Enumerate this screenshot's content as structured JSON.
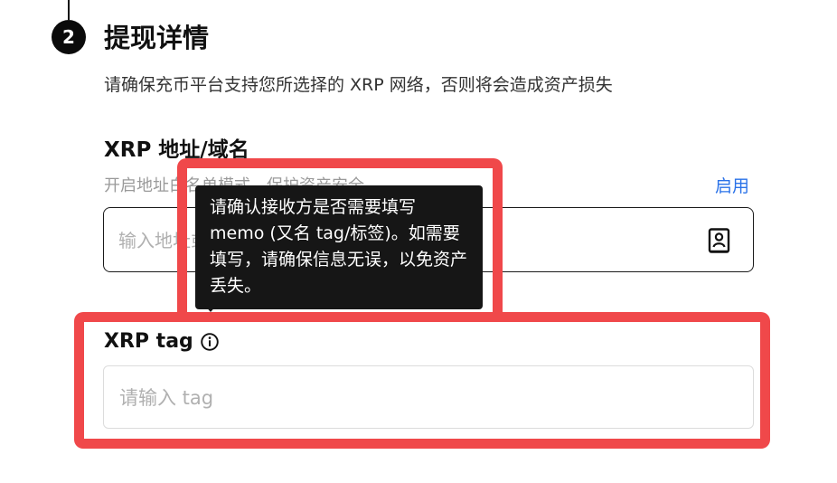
{
  "step": {
    "number": "2",
    "title": "提现详情"
  },
  "notice": "请确保充币平台支持您所选择的 XRP 网络，否则将会造成资产损失",
  "address": {
    "label": "XRP 地址/域名",
    "whitelist_hint": "开启地址白名单模式，保护资产安全",
    "enable_label": "启用",
    "placeholder": "输入地址或域名",
    "value": "",
    "address_book_icon": "address-book-icon"
  },
  "tag": {
    "label": "XRP tag",
    "info_icon": "info-icon",
    "placeholder": "请输入 tag",
    "value": ""
  },
  "tooltip": {
    "text": "请确认接收方是否需要填写 memo (又名 tag/标签)。如需要填写，请确保信息无误，以免资产丢失。"
  },
  "colors": {
    "accent": "#2a72e8",
    "highlight": "#f0484a",
    "tooltip_bg": "#161616",
    "badge_bg": "#0b0b0b"
  }
}
